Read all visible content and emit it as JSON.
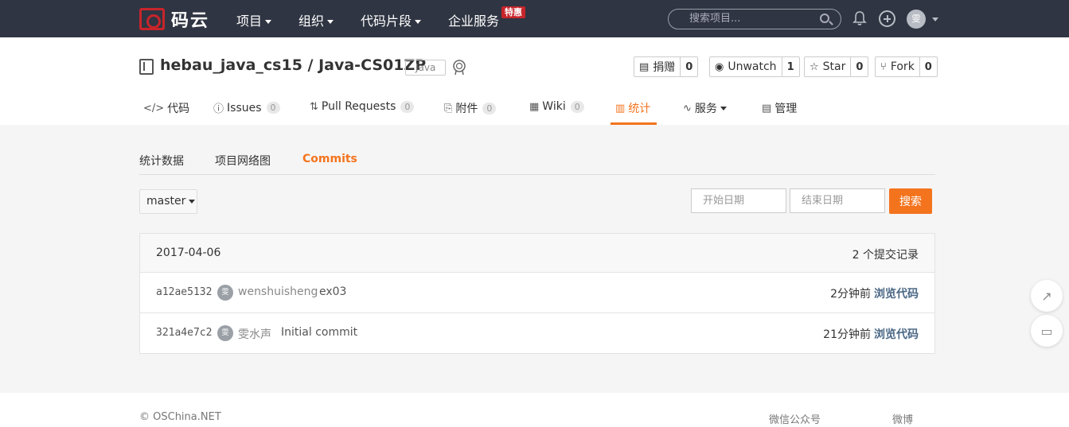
{
  "nav": {
    "logo_text": "码云",
    "items": [
      {
        "label": "项目"
      },
      {
        "label": "组织"
      },
      {
        "label": "代码片段"
      },
      {
        "label": "企业服务"
      }
    ],
    "hot_badge": "特惠",
    "search_placeholder": "搜索项目...",
    "avatar_initial": "雯"
  },
  "project": {
    "title": "hebau_java_cs15 / Java-CS01ZP",
    "language": "Java",
    "actions": [
      {
        "label": "捐赠",
        "count": "0",
        "icon": "donate-icon"
      },
      {
        "label": "Unwatch",
        "count": "1",
        "icon": "eye-icon"
      },
      {
        "label": "Star",
        "count": "0",
        "icon": "star-icon"
      },
      {
        "label": "Fork",
        "count": "0",
        "icon": "fork-icon"
      }
    ]
  },
  "tabs": [
    {
      "label": "代码",
      "icon": "code-icon"
    },
    {
      "label": "Issues",
      "count": "0",
      "icon": "issue-icon"
    },
    {
      "label": "Pull Requests",
      "count": "0",
      "icon": "pull-request-icon"
    },
    {
      "label": "附件",
      "count": "0",
      "icon": "attachment-icon"
    },
    {
      "label": "Wiki",
      "count": "0",
      "icon": "wiki-icon"
    },
    {
      "label": "统计",
      "icon": "chart-icon"
    },
    {
      "label": "服务",
      "icon": "pulse-icon"
    },
    {
      "label": "管理",
      "icon": "settings-icon"
    }
  ],
  "subtabs": [
    {
      "label": "统计数据"
    },
    {
      "label": "项目网络图"
    },
    {
      "label": "Commits"
    }
  ],
  "filters": {
    "branch": "master",
    "start_placeholder": "开始日期",
    "end_placeholder": "结束日期",
    "search_label": "搜索"
  },
  "commits": {
    "date": "2017-04-06",
    "count_label": "2 个提交记录",
    "rows": [
      {
        "sha": "a12ae5132",
        "avatar": "雯",
        "author": "wenshuisheng",
        "message": "ex03",
        "time": "2分钟前",
        "browse": "浏览代码"
      },
      {
        "sha": "321a4e7c2",
        "avatar": "雯",
        "author": "雯水声",
        "message": "Initial commit",
        "time": "21分钟前",
        "browse": "浏览代码"
      }
    ]
  },
  "footer": {
    "copyright": "© OSChina.NET",
    "wechat": "微信公众号",
    "weibo": "微博"
  },
  "colors": {
    "nav_bg": "#2f3542",
    "accent": "#f4741e",
    "brand_red": "#c7252b",
    "link": "#4a6785"
  }
}
